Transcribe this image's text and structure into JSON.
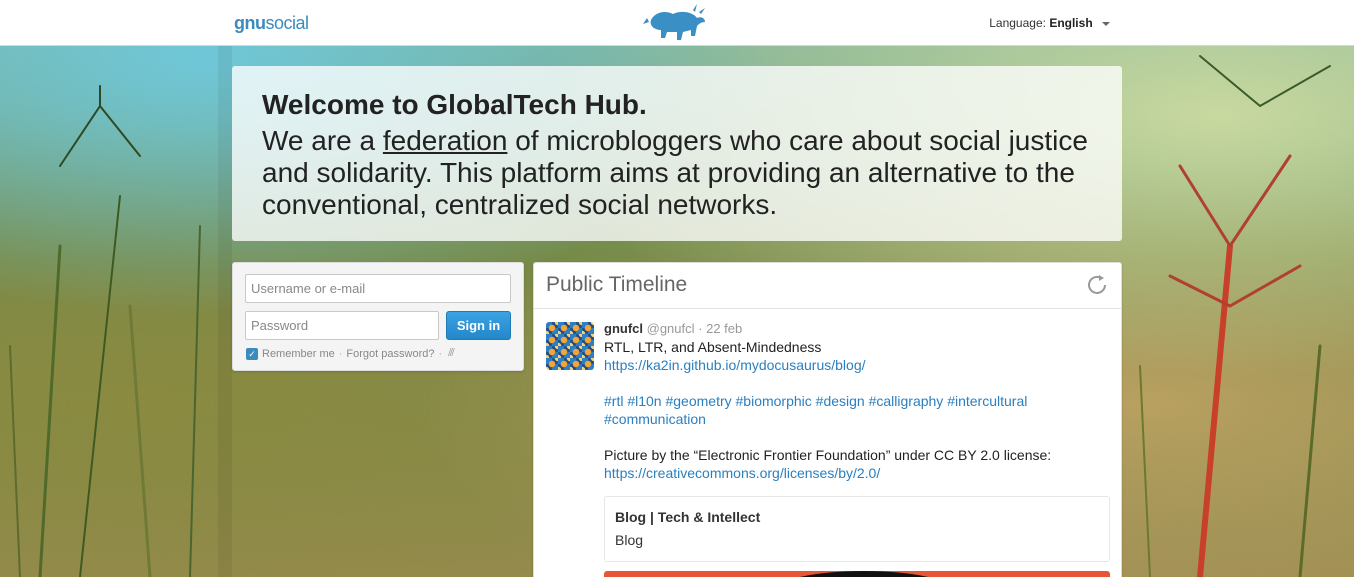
{
  "topbar": {
    "logo_gnu": "gnu",
    "logo_social": "social",
    "language_label": "Language:",
    "language_value": "English"
  },
  "hero": {
    "title": "Welcome to GlobalTech Hub.",
    "text_before": "We are a ",
    "link": "federation",
    "text_after": " of microbloggers who care about social justice and solidarity. This platform aims at providing an alternative to the conventional, centralized social networks."
  },
  "login": {
    "username_placeholder": "Username or e-mail",
    "password_placeholder": "Password",
    "signin_label": "Sign in",
    "remember_label": "Remember me",
    "separator": "·",
    "forgot_label": "Forgot password?",
    "openid_icon": "openid-icon"
  },
  "timeline": {
    "title": "Public Timeline",
    "reload_icon": "reload-icon",
    "notice": {
      "author": "gnufcl",
      "handle": "@gnufcl",
      "separator": "·",
      "date": "22 feb",
      "lines": {
        "heading": "RTL, LTR, and Absent-Mindedness",
        "blog_url": "https://ka2in.github.io/mydocusaurus/blog/",
        "tags_1": "#rtl #l10n #geometry #biomorphic #design #calligraphy #intercultural",
        "tags_2": "#communication",
        "picture_credit": "Picture by the “Electronic Frontier Foundation” under CC BY 2.0 license:",
        "license_url": "https://creativecommons.org/licenses/by/2.0/"
      },
      "attachment": {
        "title": "Blog | Tech & Intellect",
        "description": "Blog"
      }
    }
  },
  "colors": {
    "accent": "#3b8bbf",
    "link": "#2a7fbf",
    "button": "#2487c9"
  }
}
